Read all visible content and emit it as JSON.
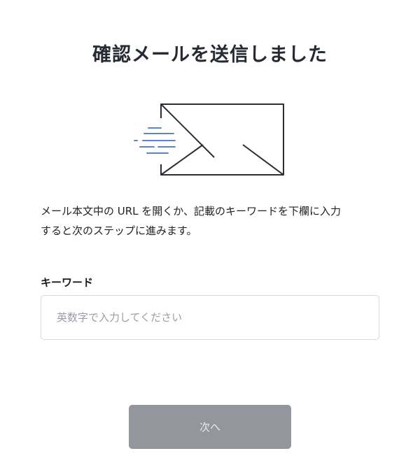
{
  "page": {
    "title": "確認メールを送信しました"
  },
  "illustration": {
    "icon": "envelope-icon",
    "accent_color": "#5b86c5",
    "stroke_color": "#2a2d33"
  },
  "description": {
    "line1": "メール本文中の URL を開くか、記載のキーワードを下欄に入力",
    "line2": "すると次のステップに進みます。"
  },
  "keyword_field": {
    "label": "キーワード",
    "value": "",
    "placeholder": "英数字で入力してください"
  },
  "next_button": {
    "label": "次へ",
    "disabled": true,
    "background": "#93979d"
  }
}
